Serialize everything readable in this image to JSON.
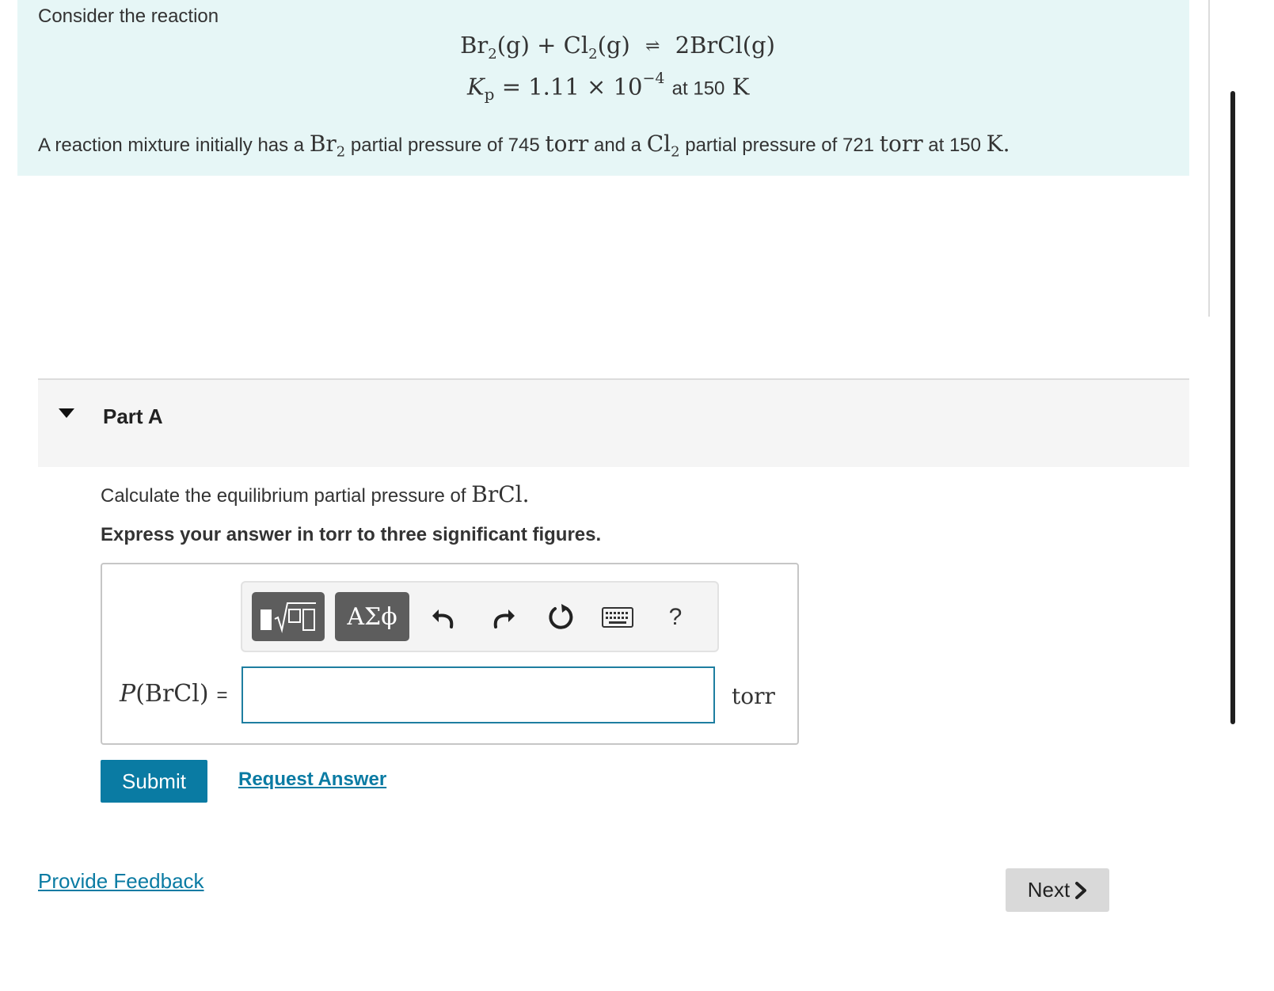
{
  "intro": {
    "lead": "Consider the reaction",
    "eq_left": "Br",
    "eq_left_sub": "2",
    "eq_plus_part": "(g) + Cl",
    "eq_cl_sub": "2",
    "eq_g": "(g)",
    "eq_arrow": "⇌",
    "eq_right": "2BrCl(g)",
    "kp_symbol": "K",
    "kp_sub": "p",
    "kp_value": "= 1.11 × 10",
    "kp_exp": "−4",
    "kp_at": "at 150",
    "kp_unit": "K",
    "desc_a": "A reaction mixture initially has a",
    "desc_br": "Br",
    "desc_br_sub": "2",
    "desc_b": "partial pressure of 745",
    "desc_torr1": "torr",
    "desc_c": "and a",
    "desc_cl": "Cl",
    "desc_cl_sub": "2",
    "desc_d": "partial pressure of 721",
    "desc_torr2": "torr",
    "desc_e": "at 150",
    "desc_k": "K."
  },
  "part": {
    "title": "Part A"
  },
  "question": {
    "text": "Calculate the equilibrium partial pressure of",
    "species": "BrCl.",
    "instruction": "Express your answer in torr to three significant figures."
  },
  "toolbar": {
    "greek_label": "ΑΣϕ",
    "help_label": "?"
  },
  "answer": {
    "label_p": "P",
    "label_species": "(BrCl)",
    "label_eq": "=",
    "value": "",
    "unit": "torr"
  },
  "actions": {
    "submit": "Submit",
    "request": "Request Answer",
    "feedback": "Provide Feedback",
    "next": "Next"
  }
}
